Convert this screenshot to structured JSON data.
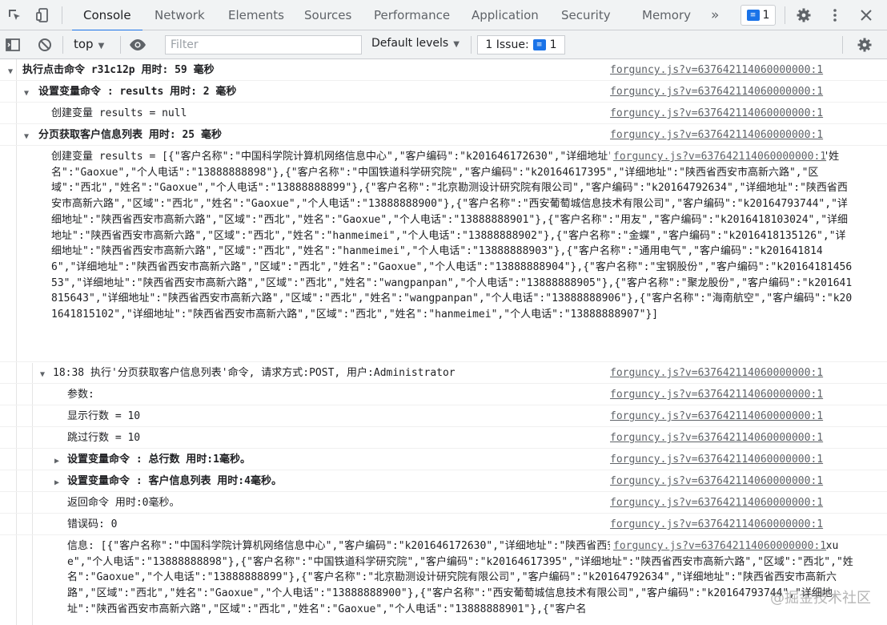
{
  "tabs": [
    "Console",
    "Network",
    "Elements",
    "Sources",
    "Performance",
    "Application",
    "Security",
    "Memory"
  ],
  "tabs_more": "»",
  "message_count": "1",
  "toolbar": {
    "context": "top",
    "filter_placeholder": "Filter",
    "levels": "Default levels",
    "issues_label": "1 Issue:",
    "issues_count": "1"
  },
  "source": "forguncy.js?v=637642114060000000:1",
  "logs": [
    {
      "text": "执行点击命令 r31c12p 用时: 59 毫秒"
    },
    {
      "text": "设置变量命令 : results 用时: 2 毫秒"
    },
    {
      "text": "创建变量 results = null"
    },
    {
      "text": "分页获取客户信息列表 用时: 25 毫秒"
    },
    {
      "text": "创建变量 results = [{\"客户名称\":\"中国科学院计算机网络信息中心\",\"客户编码\":\"k201646172630\",\"详细地址\":\"陕西省西安市高新六路\",\"区域\":\"西北\",\"姓名\":\"Gaoxue\",\"个人电话\":\"13888888898\"},{\"客户名称\":\"中国铁道科学研究院\",\"客户编码\":\"k20164617395\",\"详细地址\":\"陕西省西安市高新六路\",\"区域\":\"西北\",\"姓名\":\"Gaoxue\",\"个人电话\":\"13888888899\"},{\"客户名称\":\"北京勘测设计研究院有限公司\",\"客户编码\":\"k20164792634\",\"详细地址\":\"陕西省西安市高新六路\",\"区域\":\"西北\",\"姓名\":\"Gaoxue\",\"个人电话\":\"13888888900\"},{\"客户名称\":\"西安葡萄城信息技术有限公司\",\"客户编码\":\"k20164793744\",\"详细地址\":\"陕西省西安市高新六路\",\"区域\":\"西北\",\"姓名\":\"Gaoxue\",\"个人电话\":\"13888888901\"},{\"客户名称\":\"用友\",\"客户编码\":\"k2016418103024\",\"详细地址\":\"陕西省西安市高新六路\",\"区域\":\"西北\",\"姓名\":\"hanmeimei\",\"个人电话\":\"13888888902\"},{\"客户名称\":\"金蝶\",\"客户编码\":\"k2016418135126\",\"详细地址\":\"陕西省西安市高新六路\",\"区域\":\"西北\",\"姓名\":\"hanmeimei\",\"个人电话\":\"13888888903\"},{\"客户名称\":\"通用电气\",\"客户编码\":\"k2016418146\",\"详细地址\":\"陕西省西安市高新六路\",\"区域\":\"西北\",\"姓名\":\"Gaoxue\",\"个人电话\":\"13888888904\"},{\"客户名称\":\"宝钢股份\",\"客户编码\":\"k2016418145653\",\"详细地址\":\"陕西省西安市高新六路\",\"区域\":\"西北\",\"姓名\":\"wangpanpan\",\"个人电话\":\"13888888905\"},{\"客户名称\":\"聚龙股份\",\"客户编码\":\"k201641815643\",\"详细地址\":\"陕西省西安市高新六路\",\"区域\":\"西北\",\"姓名\":\"wangpanpan\",\"个人电话\":\"13888888906\"},{\"客户名称\":\"海南航空\",\"客户编码\":\"k201641815102\",\"详细地址\":\"陕西省西安市高新六路\",\"区域\":\"西北\",\"姓名\":\"hanmeimei\",\"个人电话\":\"13888888907\"}]"
    },
    {
      "text": "18:38 执行'分页获取客户信息列表'命令, 请求方式:POST, 用户:Administrator"
    },
    {
      "text": "参数:"
    },
    {
      "text": "显示行数 = 10"
    },
    {
      "text": "跳过行数 = 10"
    },
    {
      "text": "设置变量命令 : 总行数 用时:1毫秒。"
    },
    {
      "text": "设置变量命令 : 客户信息列表 用时:4毫秒。"
    },
    {
      "text": "返回命令 用时:0毫秒。"
    },
    {
      "text": "错误码: 0"
    },
    {
      "text": "信息: [{\"客户名称\":\"中国科学院计算机网络信息中心\",\"客户编码\":\"k201646172630\",\"详细地址\":\"陕西省西安市高新六路\",\"区域\":\"西北\",\"姓名\":\"Gaoxue\",\"个人电话\":\"13888888898\"},{\"客户名称\":\"中国铁道科学研究院\",\"客户编码\":\"k20164617395\",\"详细地址\":\"陕西省西安市高新六路\",\"区域\":\"西北\",\"姓名\":\"Gaoxue\",\"个人电话\":\"13888888899\"},{\"客户名称\":\"北京勘测设计研究院有限公司\",\"客户编码\":\"k20164792634\",\"详细地址\":\"陕西省西安市高新六路\",\"区域\":\"西北\",\"姓名\":\"Gaoxue\",\"个人电话\":\"13888888900\"},{\"客户名称\":\"西安葡萄城信息技术有限公司\",\"客户编码\":\"k20164793744\",\"详细地址\":\"陕西省西安市高新六路\",\"区域\":\"西北\",\"姓名\":\"Gaoxue\",\"个人电话\":\"13888888901\"},{\"客户名"
    }
  ],
  "watermark": "@掘金技术社区"
}
